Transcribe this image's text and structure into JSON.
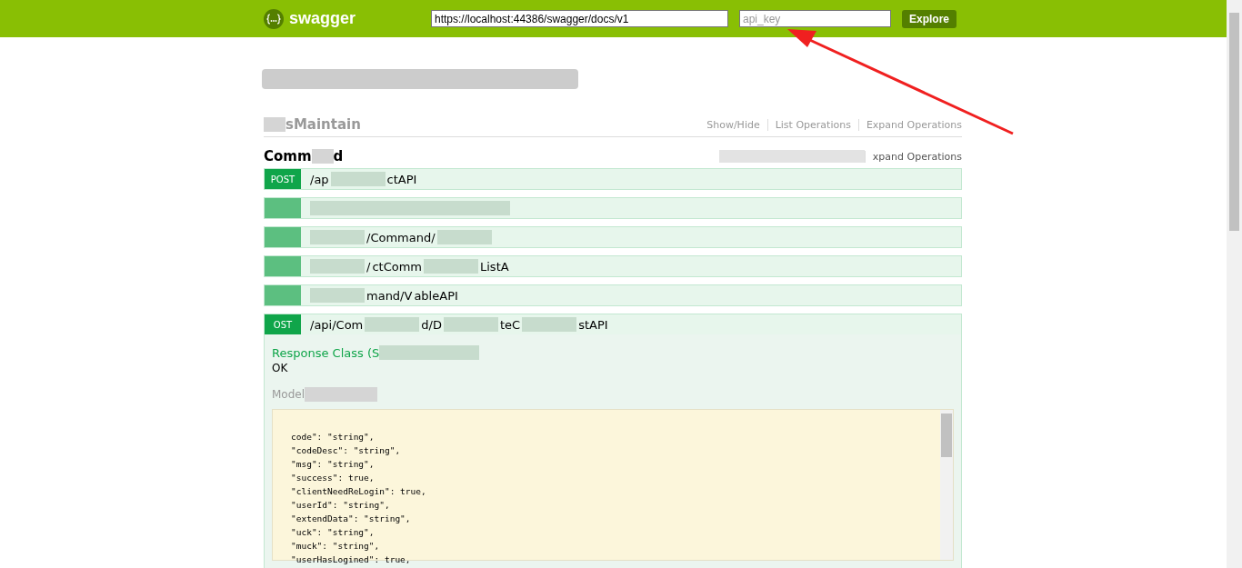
{
  "header": {
    "logo_text": "swagger",
    "url": "https://localhost:44386/swagger/docs/v1",
    "api_key_placeholder": "api_key",
    "explore": "Explore"
  },
  "resources": [
    {
      "title_parts": [
        {
          "kind": "redacted"
        },
        {
          "kind": "text",
          "text": "sMaintain"
        }
      ],
      "links": [
        {
          "kind": "text",
          "text": "Show/Hide"
        },
        {
          "kind": "text",
          "text": "List Operations"
        },
        {
          "kind": "text",
          "text": "Expand Operations"
        }
      ]
    },
    {
      "title_parts": [
        {
          "kind": "text",
          "text": "Comm"
        },
        {
          "kind": "redacted"
        },
        {
          "kind": "text",
          "text": "d"
        }
      ],
      "links": [
        {
          "kind": "redacted"
        },
        {
          "kind": "text",
          "text": "xpand Operations"
        }
      ],
      "operations": [
        {
          "method": "POST",
          "path_parts": [
            {
              "kind": "text",
              "text": "/ap"
            },
            {
              "kind": "redacted"
            },
            {
              "kind": "text",
              "text": "ctAPI"
            }
          ],
          "expanded": false
        },
        {
          "path_parts": [
            {
              "kind": "redacted"
            }
          ],
          "expanded": false
        },
        {
          "path_parts": [
            {
              "kind": "redacted"
            },
            {
              "kind": "text",
              "text": "/Command/"
            },
            {
              "kind": "redacted"
            }
          ],
          "expanded": false
        },
        {
          "path_parts": [
            {
              "kind": "redacted"
            },
            {
              "kind": "text",
              "text": "/"
            },
            {
              "kind": "text",
              "text": "ctComm"
            },
            {
              "kind": "redacted"
            },
            {
              "kind": "text",
              "text": "ListA"
            }
          ],
          "expanded": false
        },
        {
          "path_parts": [
            {
              "kind": "redacted"
            },
            {
              "kind": "text",
              "text": "mand/V"
            },
            {
              "kind": "text",
              "text": "ableAPI"
            }
          ],
          "expanded": false
        },
        {
          "method": "OST",
          "path_parts": [
            {
              "kind": "text",
              "text": "/api/Com"
            },
            {
              "kind": "redacted"
            },
            {
              "kind": "text",
              "text": "d/D"
            },
            {
              "kind": "redacted"
            },
            {
              "kind": "text",
              "text": "teC"
            },
            {
              "kind": "redacted"
            },
            {
              "kind": "text",
              "text": "stAPI"
            }
          ],
          "expanded": true,
          "response_class": "Response Class (S",
          "response_value": "OK",
          "model_label": "Model",
          "code_lines": [
            "code\": \"string\",",
            "\"codeDesc\": \"string\",",
            "\"msg\": \"string\",",
            "\"success\": true,",
            "\"clientNeedReLogin\": true,",
            "\"userId\": \"string\",",
            "\"extendData\": \"string\",",
            "\"uck\": \"string\",",
            "\"muck\": \"string\",",
            "\"userHasLogined\": true,"
          ]
        }
      ]
    }
  ]
}
